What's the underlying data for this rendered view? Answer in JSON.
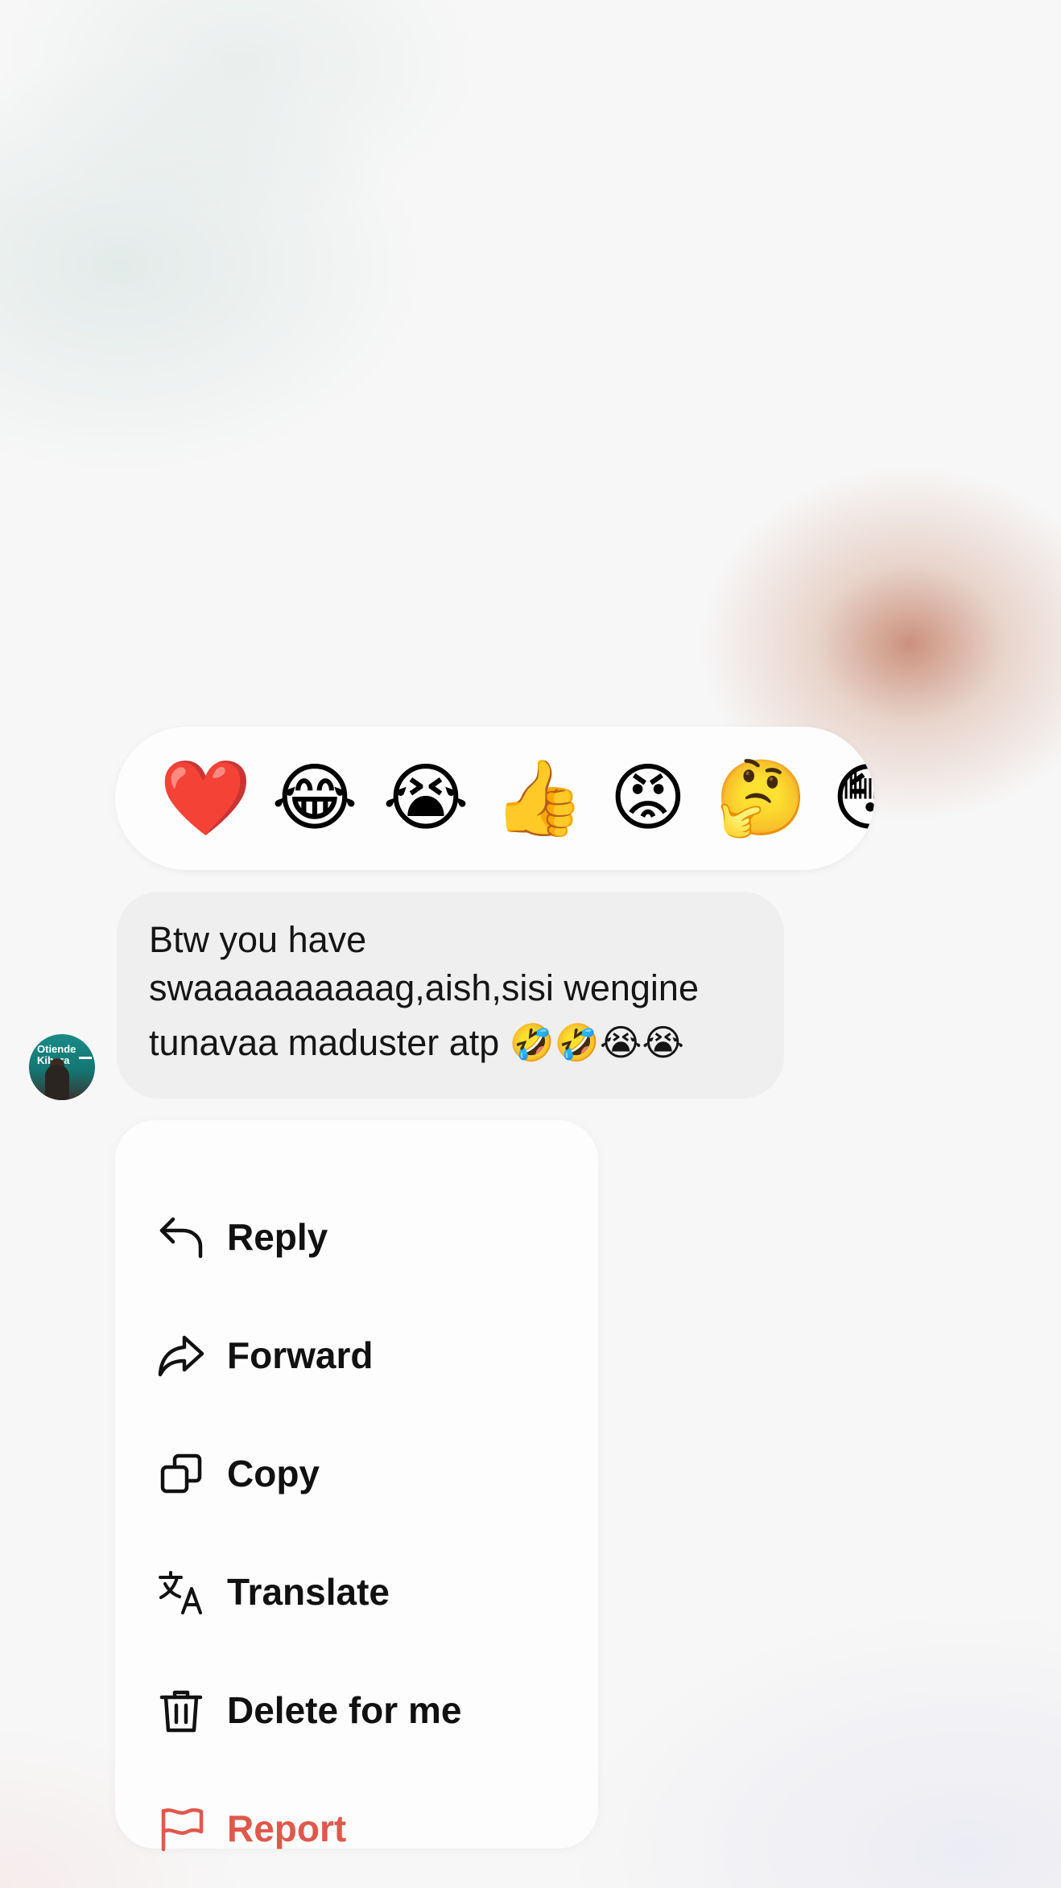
{
  "reactions": {
    "emojis": [
      {
        "glyph": "❤️",
        "name": "red-heart"
      },
      {
        "glyph": "😂",
        "name": "tears-of-joy"
      },
      {
        "glyph": "😭",
        "name": "loudly-crying"
      },
      {
        "glyph": "👍",
        "name": "thumbs-up"
      },
      {
        "glyph": "😡",
        "name": "angry-face"
      },
      {
        "glyph": "🤔",
        "name": "thinking-face"
      },
      {
        "glyph": "😳",
        "name": "flushed-face"
      }
    ]
  },
  "message": {
    "lines": [
      "Btw you have",
      "swaaaaaaaaaag,aish,sisi wengine",
      "tunavaa maduster atp 🤣🤣😭😭"
    ]
  },
  "avatar": {
    "sign_text": [
      "Otiende",
      "Kibera"
    ]
  },
  "menu": {
    "items": [
      {
        "label": "Reply",
        "icon": "reply-icon"
      },
      {
        "label": "Forward",
        "icon": "forward-icon"
      },
      {
        "label": "Copy",
        "icon": "copy-icon"
      },
      {
        "label": "Translate",
        "icon": "translate-icon"
      },
      {
        "label": "Delete for me",
        "icon": "trash-icon"
      },
      {
        "label": "Report",
        "icon": "flag-icon",
        "color": "#e0584c"
      }
    ]
  },
  "colors": {
    "bubble": "#efefef",
    "danger": "#e0584c",
    "text": "#111111"
  }
}
